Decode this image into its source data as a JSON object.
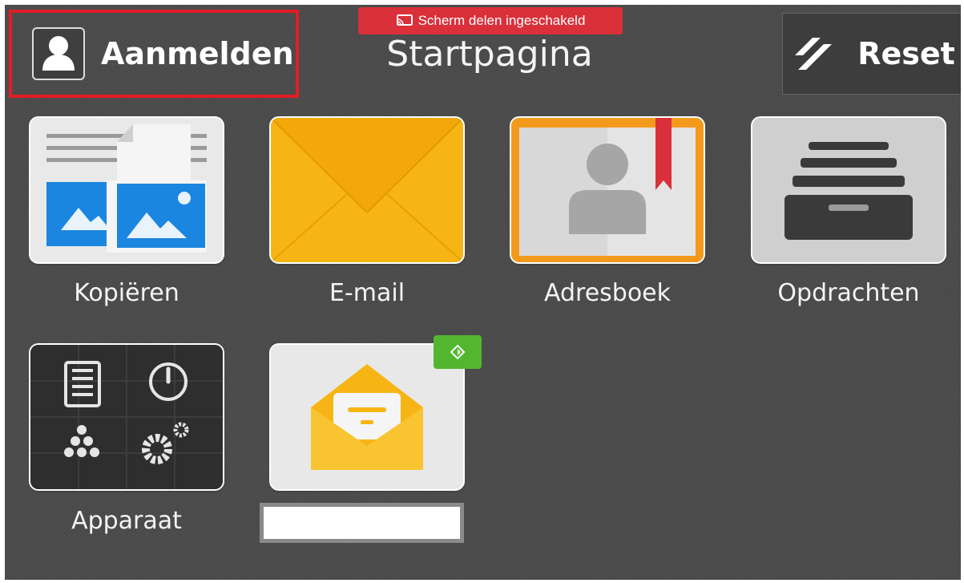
{
  "banner": {
    "text": "Scherm delen ingeschakeld",
    "icon": "screen-share-icon",
    "color": "#d9303a"
  },
  "header": {
    "login_label": "Aanmelden",
    "login_icon": "user-icon",
    "title": "Startpagina",
    "reset_label": "Reset",
    "reset_icon": "reset-icon"
  },
  "apps": [
    {
      "label": "Kopiëren",
      "icon": "copy-icon"
    },
    {
      "label": "E-mail",
      "icon": "email-icon"
    },
    {
      "label": "Adresboek",
      "icon": "address-book-icon"
    },
    {
      "label": "Opdrachten",
      "icon": "jobs-icon"
    },
    {
      "label": "Apparaat",
      "icon": "device-icon"
    },
    {
      "label": "",
      "icon": "open-mail-app-icon"
    }
  ],
  "colors": {
    "background": "#4a4a4a",
    "highlight": "#e11d26",
    "badge": "#52b72e",
    "email": "#f7b515"
  }
}
